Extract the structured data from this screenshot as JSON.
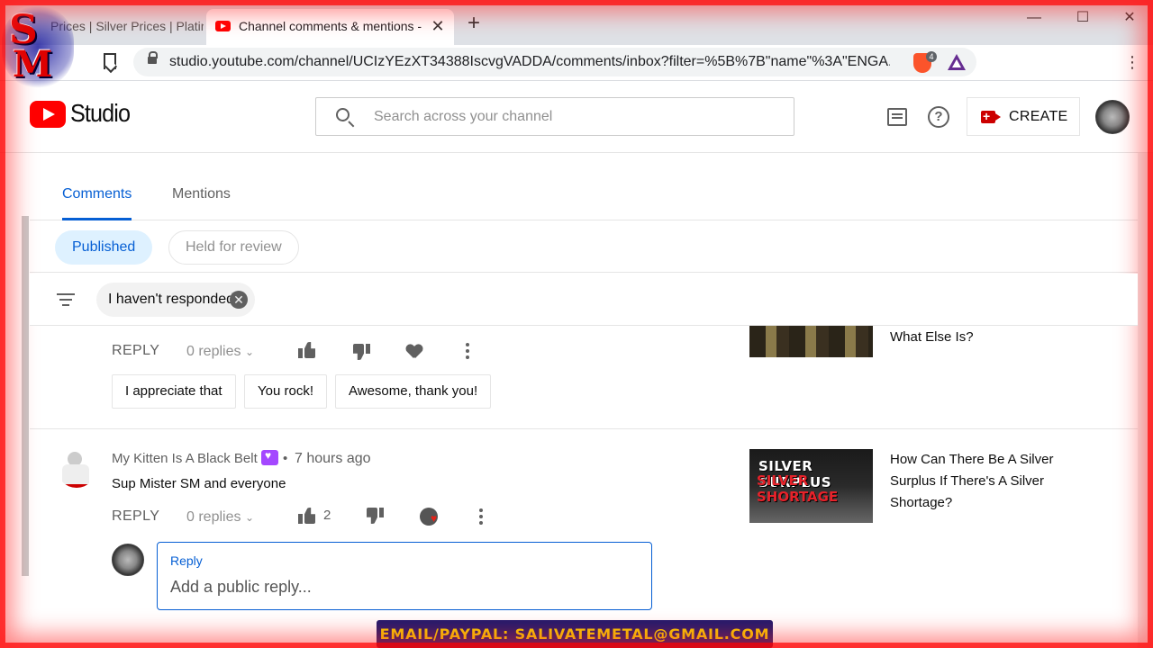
{
  "browser": {
    "inactive_tab_title": "Prices | Silver Prices | Platin",
    "active_tab_title": "Channel comments & mentions -",
    "tab_close": "✕",
    "new_tab": "+",
    "minimize": "—",
    "maximize": "☐",
    "close": "✕",
    "url": "studio.youtube.com/channel/UCIzYEzXT34388IscvgVADDA/comments/inbox?filter=%5B%7B\"name\"%3A\"ENGA...",
    "brave_badge": "4",
    "menu": "⋮"
  },
  "header": {
    "logo_text": "Studio",
    "search_placeholder": "Search across your channel",
    "help_label": "?",
    "create_label": "CREATE"
  },
  "tabs": [
    {
      "label": "Comments"
    },
    {
      "label": "Mentions"
    }
  ],
  "pills": [
    {
      "label": "Published"
    },
    {
      "label": "Held for review"
    }
  ],
  "filter": {
    "chip_label": "I haven't responded",
    "chip_close": "✕"
  },
  "comment1": {
    "reply_label": "REPLY",
    "replies": "0 replies",
    "quick_replies": [
      "I appreciate that",
      "You rock!",
      "Awesome, thank you!"
    ],
    "video_title": "What Else Is?"
  },
  "comment2": {
    "author": "My Kitten Is A Black Belt",
    "separator": "•",
    "time": "7 hours ago",
    "text": "Sup Mister SM and everyone",
    "reply_label": "REPLY",
    "replies": "0 replies",
    "likes": "2",
    "video_title": "How Can There Be A Silver Surplus If There's A Silver Shortage?",
    "thumb_line1": "SILVER SURPLUS",
    "thumb_line2": "SILVER SHORTAGE"
  },
  "reply_box": {
    "label": "Reply",
    "placeholder": "Add a public reply..."
  },
  "overlay": {
    "logo_s": "S",
    "logo_m": "M",
    "banner": "EMAIL/PAYPAL: SALIVATEMETAL@GMAIL.COM"
  },
  "colors": {
    "accent_blue": "#065fd4",
    "youtube_red": "#ff0000",
    "banner_bg": "#1e1a6e",
    "banner_text": "#f5d300"
  }
}
